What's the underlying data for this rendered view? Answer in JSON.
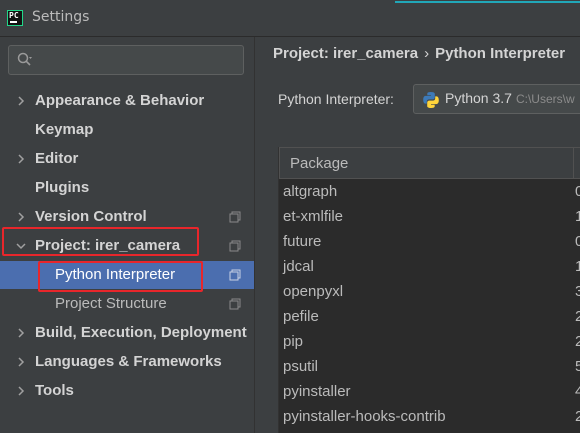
{
  "window": {
    "title": "Settings"
  },
  "search": {
    "placeholder": ""
  },
  "sidebar": {
    "items": [
      {
        "label": "Appearance & Behavior",
        "expandable": true
      },
      {
        "label": "Keymap",
        "expandable": false
      },
      {
        "label": "Editor",
        "expandable": true
      },
      {
        "label": "Plugins",
        "expandable": false
      },
      {
        "label": "Version Control",
        "expandable": true,
        "copy_icon": true
      },
      {
        "label": "Project: irer_camera",
        "expandable": true,
        "expanded": true,
        "copy_icon": true,
        "highlighted": true
      },
      {
        "label": "Python Interpreter",
        "child": true,
        "selected": true,
        "copy_icon": true,
        "highlighted": true
      },
      {
        "label": "Project Structure",
        "child": true,
        "copy_icon": true
      },
      {
        "label": "Build, Execution, Deployment",
        "expandable": true
      },
      {
        "label": "Languages & Frameworks",
        "expandable": true
      },
      {
        "label": "Tools",
        "expandable": true
      }
    ]
  },
  "breadcrumb": {
    "parent": "Project: irer_camera",
    "separator": "›",
    "current": "Python Interpreter"
  },
  "interpreter": {
    "label": "Python Interpreter:",
    "value": "Python 3.7",
    "path": "C:\\Users\\w"
  },
  "packages": {
    "column_package": "Package",
    "rows": [
      {
        "name": "altgraph",
        "version": "0"
      },
      {
        "name": "et-xmlfile",
        "version": "1"
      },
      {
        "name": "future",
        "version": "0"
      },
      {
        "name": "jdcal",
        "version": "1"
      },
      {
        "name": "openpyxl",
        "version": "3"
      },
      {
        "name": "pefile",
        "version": "2"
      },
      {
        "name": "pip",
        "version": "2"
      },
      {
        "name": "psutil",
        "version": "5"
      },
      {
        "name": "pyinstaller",
        "version": "4"
      },
      {
        "name": "pyinstaller-hooks-contrib",
        "version": "2"
      }
    ]
  },
  "colors": {
    "accent": "#4b6eaf",
    "highlight_box": "#e8262b",
    "background": "#3c3f41",
    "table_bg": "#2b2b2b"
  }
}
